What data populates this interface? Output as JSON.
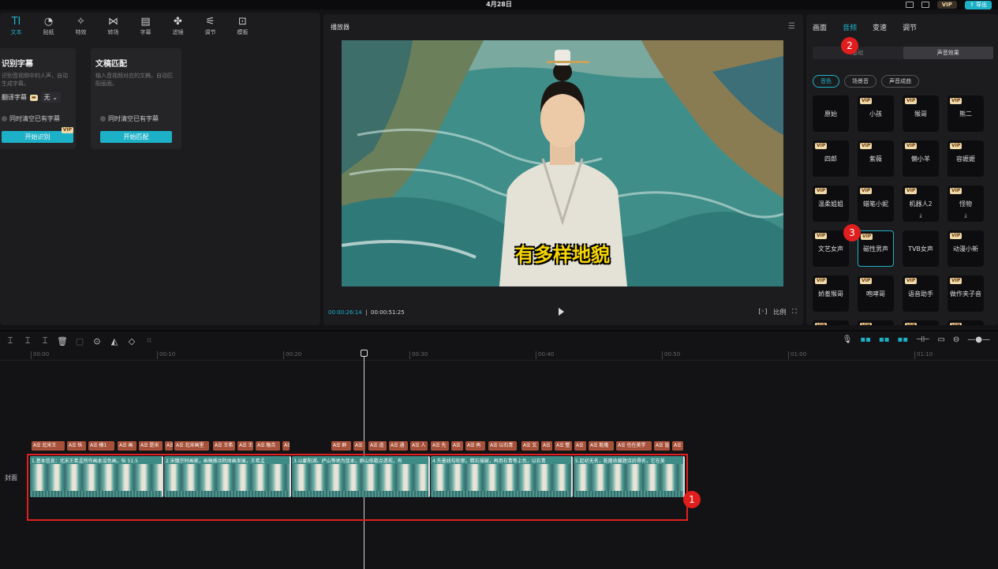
{
  "topbar": {
    "date": "4月28日",
    "vip": "VIP",
    "export": "导出"
  },
  "toolbar": [
    {
      "icon": "TI",
      "label": "文本",
      "active": true
    },
    {
      "icon": "◔",
      "label": "贴纸"
    },
    {
      "icon": "✧",
      "label": "特效"
    },
    {
      "icon": "⋈",
      "label": "转场"
    },
    {
      "icon": "▤",
      "label": "字幕"
    },
    {
      "icon": "✤",
      "label": "滤镜"
    },
    {
      "icon": "⚟",
      "label": "调节"
    },
    {
      "icon": "⊡",
      "label": "模板"
    }
  ],
  "card1": {
    "title": "识别字幕",
    "desc": "识别音视频中的人声，自动生成字幕。",
    "translate_label": "翻译字幕",
    "translate_value": "无",
    "checkbox": "同时清空已有字幕",
    "button": "开始识别",
    "vip": "VIP"
  },
  "card2": {
    "title": "文稿匹配",
    "desc": "输入音视频对应的文稿，自动匹配画面。",
    "checkbox": "同时清空已有字幕",
    "button": "开始匹配"
  },
  "player": {
    "title": "播放器",
    "subtitle": "有多样地貌",
    "current_time": "00:00:26:14",
    "total_time": "00:00:51:25",
    "ratio": "比例"
  },
  "right": {
    "tabs": [
      "画面",
      "音频",
      "变速",
      "调节"
    ],
    "active_tab": 1,
    "segment": [
      "基础",
      "声音效果"
    ],
    "pills": [
      "音色",
      "场景音",
      "声音成曲"
    ],
    "voices": [
      {
        "name": "原始",
        "vip": false
      },
      {
        "name": "小孩",
        "vip": true
      },
      {
        "name": "猴哥",
        "vip": true
      },
      {
        "name": "熊二",
        "vip": true
      },
      {
        "name": "四郎",
        "vip": true
      },
      {
        "name": "紫薇",
        "vip": true
      },
      {
        "name": "懒小羊",
        "vip": true
      },
      {
        "name": "容嬷嬷",
        "vip": true
      },
      {
        "name": "温柔姐姐",
        "vip": true
      },
      {
        "name": "蜡笔小妮",
        "vip": true
      },
      {
        "name": "机器人2",
        "vip": true,
        "download": true
      },
      {
        "name": "怪物",
        "vip": true,
        "download": true
      },
      {
        "name": "文艺女声",
        "vip": true
      },
      {
        "name": "磁性男声",
        "vip": true,
        "selected": true
      },
      {
        "name": "TVB女声",
        "vip": false
      },
      {
        "name": "动漫小新",
        "vip": true
      },
      {
        "name": "娇羞猴哥",
        "vip": true
      },
      {
        "name": "咆哮哥",
        "vip": true
      },
      {
        "name": "语音助手",
        "vip": true
      },
      {
        "name": "做作夹子音",
        "vip": true
      },
      {
        "name": "",
        "vip": true
      },
      {
        "name": "",
        "vip": true
      },
      {
        "name": "",
        "vip": true
      },
      {
        "name": "",
        "vip": true
      }
    ]
  },
  "timeline": {
    "ruler": [
      "00:00",
      "00:10",
      "00:20",
      "00:30",
      "00:40",
      "00:50",
      "01:00",
      "01:10"
    ],
    "cover_label": "封面",
    "subtitles": [
      {
        "t": "A☰ 北宋王",
        "l": 0,
        "w": 42
      },
      {
        "t": "A☰ 纵",
        "l": 45,
        "w": 24
      },
      {
        "t": "A☰ 横1",
        "l": 72,
        "w": 33
      },
      {
        "t": "A☰ 画",
        "l": 109,
        "w": 24
      },
      {
        "t": "A☰ 是宋",
        "l": 136,
        "w": 30
      },
      {
        "t": "A☰",
        "l": 169,
        "w": 10
      },
      {
        "t": "A☰ 北宋画里",
        "l": 181,
        "w": 44
      },
      {
        "t": "A☰ 王希",
        "l": 230,
        "w": 28
      },
      {
        "t": "A☰ 王",
        "l": 261,
        "w": 20
      },
      {
        "t": "A☰ 融合",
        "l": 284,
        "w": 31
      },
      {
        "t": "A☰",
        "l": 318,
        "w": 9
      },
      {
        "t": "A☰ 群",
        "l": 380,
        "w": 25
      },
      {
        "t": "A☰",
        "l": 408,
        "w": 15
      },
      {
        "t": "A☰ 道",
        "l": 427,
        "w": 23
      },
      {
        "t": "A☰ 通",
        "l": 453,
        "w": 24
      },
      {
        "t": "A☰ 人",
        "l": 480,
        "w": 22
      },
      {
        "t": "A☰ 先",
        "l": 506,
        "w": 23
      },
      {
        "t": "A☰",
        "l": 532,
        "w": 15
      },
      {
        "t": "A☰ 再",
        "l": 550,
        "w": 25
      },
      {
        "t": "A☰ 以石青",
        "l": 579,
        "w": 36
      },
      {
        "t": "A☰ 又",
        "l": 621,
        "w": 22
      },
      {
        "t": "A☰",
        "l": 646,
        "w": 14
      },
      {
        "t": "A☰ 整",
        "l": 663,
        "w": 22
      },
      {
        "t": "A☰",
        "l": 688,
        "w": 15
      },
      {
        "t": "A☰ 乾隆",
        "l": 706,
        "w": 32
      },
      {
        "t": "A☰ 也在美学",
        "l": 741,
        "w": 45
      },
      {
        "t": "A☰ 盲",
        "l": 789,
        "w": 20
      },
      {
        "t": "A☰",
        "l": 812,
        "w": 14
      }
    ],
    "clips": [
      {
        "t": "1.基本信息：北宋王希孟所作画本设色画，纵 51.5",
        "l": 0,
        "w": 169
      },
      {
        "t": "2.宋徽宗时画家，画稿推动院体画发展，王希孟",
        "l": 170,
        "w": 161
      },
      {
        "t": "3.以鄱阳湖、庐山等地为蓝本，群山依歇点透视，有",
        "l": 332,
        "w": 175
      },
      {
        "t": "4.先墨线勾轮廓，精石描皴，再用石青等上色，以石青",
        "l": 508,
        "w": 180
      },
      {
        "t": "5.起初无名，乾隆收藏题诗后得名，它在美",
        "l": 689,
        "w": 141
      }
    ]
  },
  "annotations": [
    "1",
    "2",
    "3"
  ]
}
